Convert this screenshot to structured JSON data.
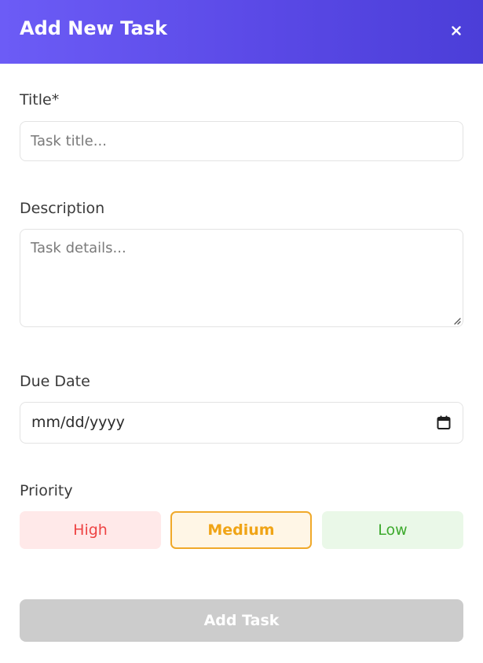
{
  "header": {
    "title": "Add New Task",
    "close_icon": "close-icon",
    "gradient_start": "#6c5cf6",
    "gradient_end": "#4b3ed8"
  },
  "form": {
    "title_label": "Title*",
    "title_placeholder": "Task title...",
    "title_value": "",
    "description_label": "Description",
    "description_placeholder": "Task details...",
    "description_value": "",
    "due_date_label": "Due Date",
    "due_date_placeholder": "mm/dd/yyyy",
    "calendar_icon": "calendar-icon",
    "priority_label": "Priority",
    "priority_options": [
      {
        "label": "High",
        "color": "#ee4444",
        "background": "#ffe9e9",
        "selected": false
      },
      {
        "label": "Medium",
        "color": "#f0a416",
        "background": "#fff6e6",
        "selected": true
      },
      {
        "label": "Low",
        "color": "#3eaa2e",
        "background": "#eaf8e8",
        "selected": false
      }
    ],
    "submit_label": "Add Task",
    "submit_disabled": true,
    "submit_color": "#cccccc"
  }
}
